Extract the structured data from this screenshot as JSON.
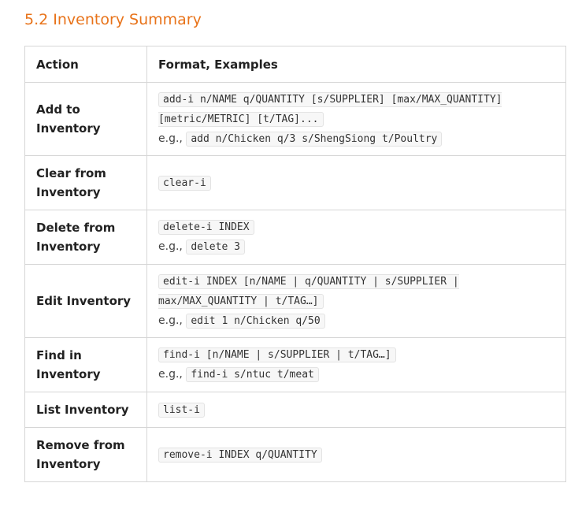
{
  "section": {
    "title": "5.2 Inventory Summary"
  },
  "table": {
    "headers": [
      "Action",
      "Format, Examples"
    ],
    "rows": [
      {
        "action": "Add to Inventory",
        "format": "add-i n/NAME q/QUANTITY [s/SUPPLIER] [max/MAX_QUANTITY] [metric/METRIC] [t/TAG]...",
        "eg_label": "e.g.,",
        "example": "add n/Chicken q/3 s/ShengSiong t/Poultry"
      },
      {
        "action": "Clear from Inventory",
        "format": "clear-i"
      },
      {
        "action": "Delete from Inventory",
        "format": "delete-i INDEX",
        "eg_label": "e.g.,",
        "example": "delete 3"
      },
      {
        "action": "Edit Inventory",
        "format": "edit-i INDEX [n/NAME | q/QUANTITY | s/SUPPLIER | max/MAX_QUANTITY | t/TAG…]",
        "eg_label": "e.g.,",
        "example": "edit 1 n/Chicken q/50"
      },
      {
        "action": "Find in Inventory",
        "format": "find-i [n/NAME | s/SUPPLIER | t/TAG…]",
        "eg_label": "e.g.,",
        "example": "find-i s/ntuc t/meat"
      },
      {
        "action": "List Inventory",
        "format": "list-i"
      },
      {
        "action": "Remove from Inventory",
        "format": "remove-i INDEX q/QUANTITY"
      }
    ]
  }
}
